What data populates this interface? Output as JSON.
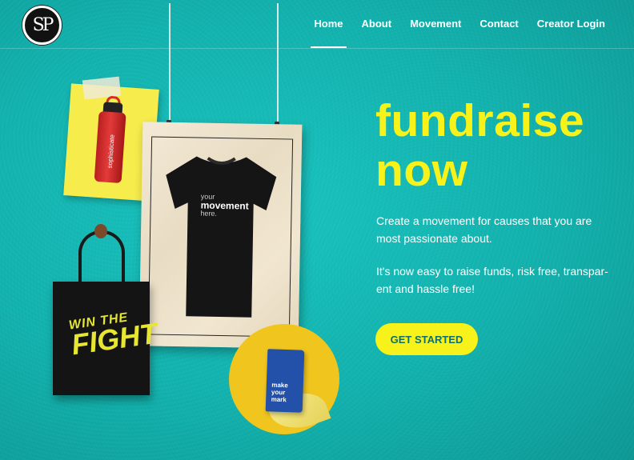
{
  "logo": {
    "text": "SP"
  },
  "nav": {
    "items": [
      {
        "label": "Home",
        "active": true
      },
      {
        "label": "About"
      },
      {
        "label": "Movement"
      },
      {
        "label": "Contact"
      },
      {
        "label": "Creator Login"
      }
    ]
  },
  "products": {
    "bottle_brand": "sophisticate",
    "tshirt_lines": [
      "your",
      "movement",
      "here."
    ],
    "tote_lines": [
      "WIN THE",
      "FIGHT"
    ],
    "notebook_lines": [
      "make",
      "your",
      "mark"
    ]
  },
  "hero": {
    "title_line1": "fundraise",
    "title_line2": "now",
    "paragraph1": "Create a movement for causes that you are most passionate about.",
    "paragraph2": "It's now easy to raise funds, risk free, transpar-ent and hassle free!",
    "cta_label": "GET STARTED"
  },
  "colors": {
    "background": "#12b1ad",
    "accent_yellow": "#f7f21a",
    "cta_text": "#0e6f6c"
  }
}
